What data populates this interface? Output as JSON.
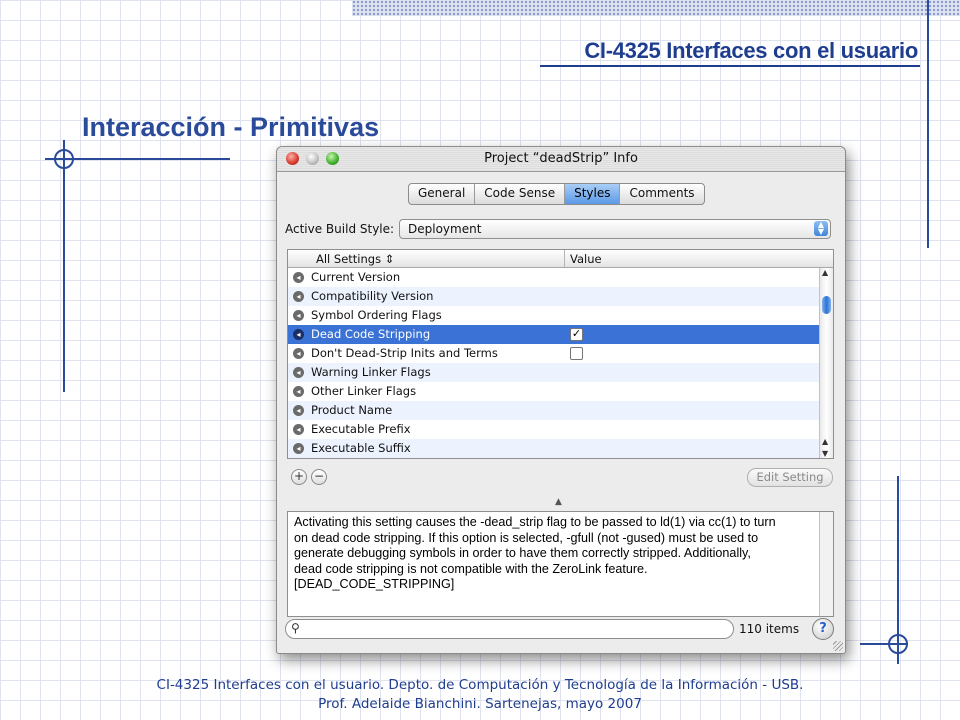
{
  "slide": {
    "course_title": "CI-4325 Interfaces con el usuario",
    "title": "Interacción - Primitivas",
    "footer_line1": "CI-4325 Interfaces con el usuario. Depto. de Computación y Tecnología de la Información - USB.",
    "footer_line2": "Prof. Adelaide Bianchini. Sartenejas, mayo 2007"
  },
  "window": {
    "title": "Project “deadStrip” Info",
    "tabs": [
      {
        "label": "General",
        "active": false
      },
      {
        "label": "Code Sense",
        "active": false
      },
      {
        "label": "Styles",
        "active": true
      },
      {
        "label": "Comments",
        "active": false
      }
    ],
    "build_style_label": "Active Build Style:",
    "build_style_value": "Deployment",
    "table": {
      "col_settings": "All Settings",
      "col_value": "Value",
      "rows": [
        {
          "label": "Current Version",
          "checkbox": null,
          "selected": false
        },
        {
          "label": "Compatibility Version",
          "checkbox": null,
          "selected": false
        },
        {
          "label": "Symbol Ordering Flags",
          "checkbox": null,
          "selected": false
        },
        {
          "label": "Dead Code Stripping",
          "checkbox": true,
          "selected": true
        },
        {
          "label": "Don't Dead-Strip Inits and Terms",
          "checkbox": false,
          "selected": false
        },
        {
          "label": "Warning Linker Flags",
          "checkbox": null,
          "selected": false
        },
        {
          "label": "Other Linker Flags",
          "checkbox": null,
          "selected": false
        },
        {
          "label": "Product Name",
          "checkbox": null,
          "selected": false
        },
        {
          "label": "Executable Prefix",
          "checkbox": null,
          "selected": false
        },
        {
          "label": "Executable Suffix",
          "checkbox": null,
          "selected": false
        }
      ]
    },
    "add_symbol": "+",
    "remove_symbol": "−",
    "edit_setting_label": "Edit Setting",
    "description": "Activating this setting causes the -dead_strip flag to be passed to ld(1) via cc(1) to turn\non dead code stripping.  If this option is selected, -gfull (not -gused) must be used to\ngenerate debugging symbols in order to have them correctly stripped.  Additionally,\ndead code stripping is not compatible with the ZeroLink feature.\n[DEAD_CODE_STRIPPING]",
    "search_value": "",
    "items_count": "110 items",
    "help_symbol": "?",
    "colors": {
      "selection": "#3a72d5",
      "accent": "#1f3d8f"
    }
  }
}
